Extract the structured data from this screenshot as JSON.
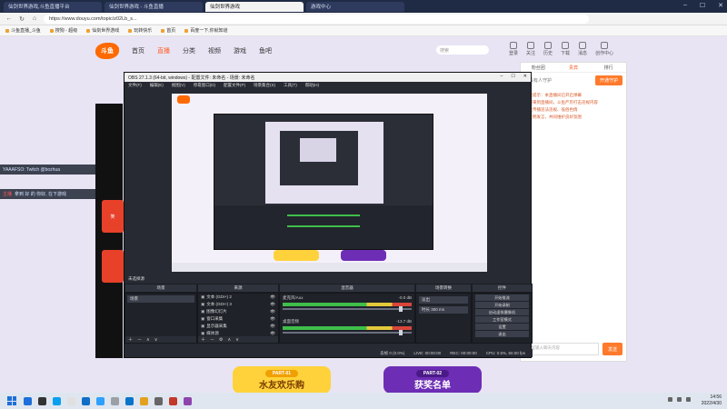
{
  "browser": {
    "tabs": [
      {
        "title": "仙剑世界游戏,斗鱼直播平台",
        "active": false
      },
      {
        "title": "仙剑世界游戏 - 斗鱼直播",
        "active": false
      },
      {
        "title": "仙剑世界游戏",
        "active": true
      },
      {
        "title": "游戏中心",
        "active": false
      }
    ],
    "url": "https://www.douyu.com/topic/z02Lb_s...",
    "bookmarks": [
      "斗鱼直播_斗鱼",
      "搜狗 - 超级",
      "仙剑世界游戏",
      "玩转快乐",
      "首页",
      "百度一下,你就知道"
    ]
  },
  "site": {
    "logo": "斗鱼",
    "nav": [
      "首页",
      "直播",
      "分类",
      "视频",
      "游戏",
      "鱼吧"
    ],
    "nav_active": "直播",
    "search_placeholder": "搜索",
    "user_icons": [
      "登录",
      "关注",
      "历史",
      "下载",
      "消息",
      "创作中心"
    ],
    "danmaku": [
      {
        "user": "",
        "text": "YAAAFSO: Twitch @bozhua"
      },
      {
        "user": "主播",
        "text": "拿到 好 的 你好, 在下游戏"
      }
    ],
    "chat": {
      "tabs": [
        "粉丝团",
        "贵宾",
        "排行"
      ],
      "active_tab": "贵宾",
      "fan_prompt": "还没有人守护",
      "open_guard": "开通守护",
      "lines": [
        "系统提示：本直播间已开启弹幕",
        "欢迎来到直播间，斗鱼严厉打击违规内容",
        "禁止传播违法违规、低俗色情",
        "请文明发言，共同维护良好氛围"
      ],
      "input_placeholder": "这里输入聊天内容",
      "send": "发送"
    },
    "side_ad": "笑",
    "banners": [
      {
        "sub": "PART-01",
        "main": "水友欢乐购"
      },
      {
        "sub": "PART-02",
        "main": "获奖名单"
      }
    ]
  },
  "obs": {
    "title": "OBS 27.1.3 (64-bit, windows) - 配置文件: 未命名 - 场景: 未命名",
    "menu": [
      "文件(F)",
      "编辑(E)",
      "视图(V)",
      "停靠窗口(D)",
      "配置文件(P)",
      "场景集合(S)",
      "工具(T)",
      "帮助(H)"
    ],
    "scene_label": "未选择源",
    "panels": [
      "场景",
      "来源",
      "混音器",
      "场景转换",
      "控件"
    ],
    "scenes": [
      "场景"
    ],
    "sources": [
      "文本 (GDI+) 2",
      "文本 (GDI+) 3",
      "图像幻灯片",
      "窗口采集",
      "显示器采集",
      "媒体源"
    ],
    "mixer": [
      {
        "name": "麦克风/Aux",
        "db": "-0.0 dB"
      },
      {
        "name": "桌面音频",
        "db": "-13.7 dB"
      }
    ],
    "transitions": {
      "type": "淡出",
      "duration_label": "时长",
      "duration": "300 ms"
    },
    "controls": [
      "开始推流",
      "开始录制",
      "启动虚拟摄像机",
      "工作室模式",
      "设置",
      "退出"
    ],
    "status": {
      "dropped": "丢帧 0 (0.0%)",
      "live": "LIVE: 00:00:00",
      "rec": "REC: 00:00:00",
      "cpu": "CPU: 0.5%, 60.00 fps"
    }
  },
  "taskbar": {
    "time": "14:56",
    "date": "2022/4/30",
    "icon_colors": [
      "#1e6fd9",
      "#333333",
      "#0aa0f0",
      "#e0e0e0",
      "#0f6fc6",
      "#2fa0ff",
      "#9aa0a6",
      "#0a74c9",
      "#e2a11e",
      "#666666",
      "#c0392b",
      "#8e44ad"
    ]
  }
}
